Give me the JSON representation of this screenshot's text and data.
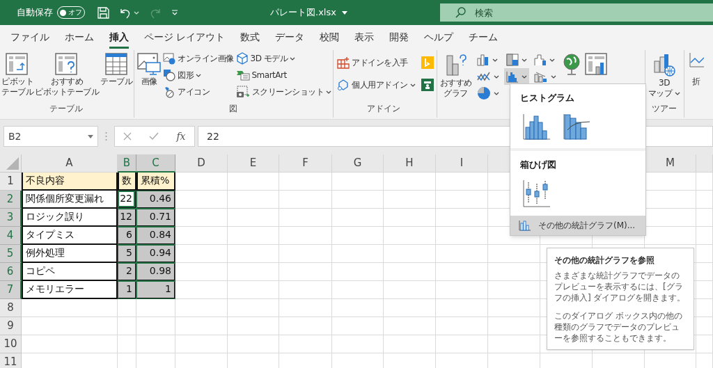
{
  "title_bar": {
    "autosave_label": "自動保存",
    "autosave_toggle": {
      "label": "オフ",
      "on": false
    },
    "redo_disabled": true,
    "file_name": "パレート図.xlsx",
    "search_placeholder": "検索"
  },
  "tabs": [
    {
      "label": "ファイル",
      "selected": false
    },
    {
      "label": "ホーム",
      "selected": false
    },
    {
      "label": "挿入",
      "selected": true
    },
    {
      "label": "ページ レイアウト",
      "selected": false
    },
    {
      "label": "数式",
      "selected": false
    },
    {
      "label": "データ",
      "selected": false
    },
    {
      "label": "校閲",
      "selected": false
    },
    {
      "label": "表示",
      "selected": false
    },
    {
      "label": "開発",
      "selected": false
    },
    {
      "label": "ヘルプ",
      "selected": false
    },
    {
      "label": "チーム",
      "selected": false
    }
  ],
  "ribbon": {
    "table_group": {
      "label": "テーブル",
      "buttons": [
        {
          "lines": [
            "ピボット",
            "テーブル"
          ]
        },
        {
          "lines": [
            "おすすめ",
            "ピボットテーブル"
          ]
        },
        {
          "lines": [
            "テーブル"
          ]
        }
      ]
    },
    "illustrations_group": {
      "label": "図",
      "picture": {
        "lines": [
          "画像"
        ]
      },
      "small": [
        {
          "label": "オンライン画像",
          "caret": false
        },
        {
          "label": "図形",
          "caret": true
        },
        {
          "label": "アイコン",
          "caret": false
        },
        {
          "label": "3D モデル",
          "caret": true
        },
        {
          "label": "SmartArt",
          "caret": false
        },
        {
          "label": "スクリーンショット",
          "caret": true
        }
      ]
    },
    "addins_group": {
      "label": "アドイン",
      "small": [
        {
          "label": "アドインを入手",
          "caret": false
        },
        {
          "label": "個人用アドイン",
          "caret": true
        }
      ]
    },
    "charts_group": {
      "recommended": {
        "lines": [
          "おすすめ",
          "グラフ"
        ]
      },
      "chart_buttons": [
        {
          "selected": false
        },
        {
          "selected": false
        },
        {
          "selected": false
        },
        {
          "selected": false
        },
        {
          "selected": true
        },
        {
          "selected": false
        },
        {
          "selected": false
        }
      ]
    },
    "tours_group": {
      "label": "ツアー",
      "map3d": {
        "lines": [
          "3D",
          "マップ"
        ]
      }
    },
    "sparkline_cut": {
      "lines": [
        "折"
      ]
    }
  },
  "formula_bar": {
    "name_box": "B2",
    "fx": "fx",
    "value": "22"
  },
  "sheet": {
    "columns": [
      {
        "label": "A",
        "selected": false
      },
      {
        "label": "B",
        "selected": true
      },
      {
        "label": "C",
        "selected": true
      },
      {
        "label": "D",
        "selected": false
      },
      {
        "label": "E",
        "selected": false
      },
      {
        "label": "F",
        "selected": false
      },
      {
        "label": "G",
        "selected": false
      },
      {
        "label": "H",
        "selected": false
      },
      {
        "label": "I",
        "selected": false
      },
      {},
      {},
      {},
      {
        "label": "M",
        "selected": false
      },
      {}
    ],
    "rows": [
      {
        "label": "1",
        "selected": false,
        "cells": [
          {
            "text": "不良内容",
            "kind": "header",
            "selected": false,
            "active": false
          },
          {
            "text": "数",
            "kind": "header",
            "selected": false,
            "active": false
          },
          {
            "text": "累積%",
            "kind": "header",
            "selected": false,
            "active": false
          }
        ]
      },
      {
        "label": "2",
        "selected": true,
        "cells": [
          {
            "text": "関係個所変更漏れ",
            "kind": "text",
            "selected": false,
            "active": false
          },
          {
            "text": "22",
            "kind": "number",
            "selected": true,
            "active": true
          },
          {
            "text": "0.46",
            "kind": "number",
            "selected": true,
            "active": false
          }
        ]
      },
      {
        "label": "3",
        "selected": true,
        "cells": [
          {
            "text": "ロジック誤り",
            "kind": "text",
            "selected": false,
            "active": false
          },
          {
            "text": "12",
            "kind": "number",
            "selected": true,
            "active": false
          },
          {
            "text": "0.71",
            "kind": "number",
            "selected": true,
            "active": false
          }
        ]
      },
      {
        "label": "4",
        "selected": true,
        "cells": [
          {
            "text": "タイプミス",
            "kind": "text",
            "selected": false,
            "active": false
          },
          {
            "text": "6",
            "kind": "number",
            "selected": true,
            "active": false
          },
          {
            "text": "0.84",
            "kind": "number",
            "selected": true,
            "active": false
          }
        ]
      },
      {
        "label": "5",
        "selected": true,
        "cells": [
          {
            "text": "例外処理",
            "kind": "text",
            "selected": false,
            "active": false
          },
          {
            "text": "5",
            "kind": "number",
            "selected": true,
            "active": false
          },
          {
            "text": "0.94",
            "kind": "number",
            "selected": true,
            "active": false
          }
        ]
      },
      {
        "label": "6",
        "selected": true,
        "cells": [
          {
            "text": "コピペ",
            "kind": "text",
            "selected": false,
            "active": false
          },
          {
            "text": "2",
            "kind": "number",
            "selected": true,
            "active": false
          },
          {
            "text": "0.98",
            "kind": "number",
            "selected": true,
            "active": false
          }
        ]
      },
      {
        "label": "7",
        "selected": true,
        "cells": [
          {
            "text": "メモリエラー",
            "kind": "text",
            "selected": false,
            "active": false
          },
          {
            "text": "1",
            "kind": "number",
            "selected": true,
            "active": false
          },
          {
            "text": "1",
            "kind": "number",
            "selected": true,
            "active": false
          }
        ]
      },
      {
        "label": "8",
        "selected": false
      },
      {
        "label": "9",
        "selected": false
      },
      {
        "label": "10",
        "selected": false
      },
      {
        "label": "11",
        "selected": false
      }
    ]
  },
  "stats_menu": {
    "sections": [
      {
        "title": "ヒストグラム",
        "kind": "histogram"
      },
      {
        "title": "箱ひげ図",
        "kind": "boxplot"
      }
    ],
    "more": {
      "label": "その他の統計グラフ(M)...",
      "selected": true
    }
  },
  "tooltip": {
    "title": "その他の統計グラフを参照",
    "paragraphs": [
      "さまざまな統計グラフでデータのプレビューを表示するには、[グラフの挿入] ダイアログを開きます。",
      "このダイアログ ボックス内の他の種類のグラフでデータのプレビューを参照することもできます。"
    ]
  }
}
